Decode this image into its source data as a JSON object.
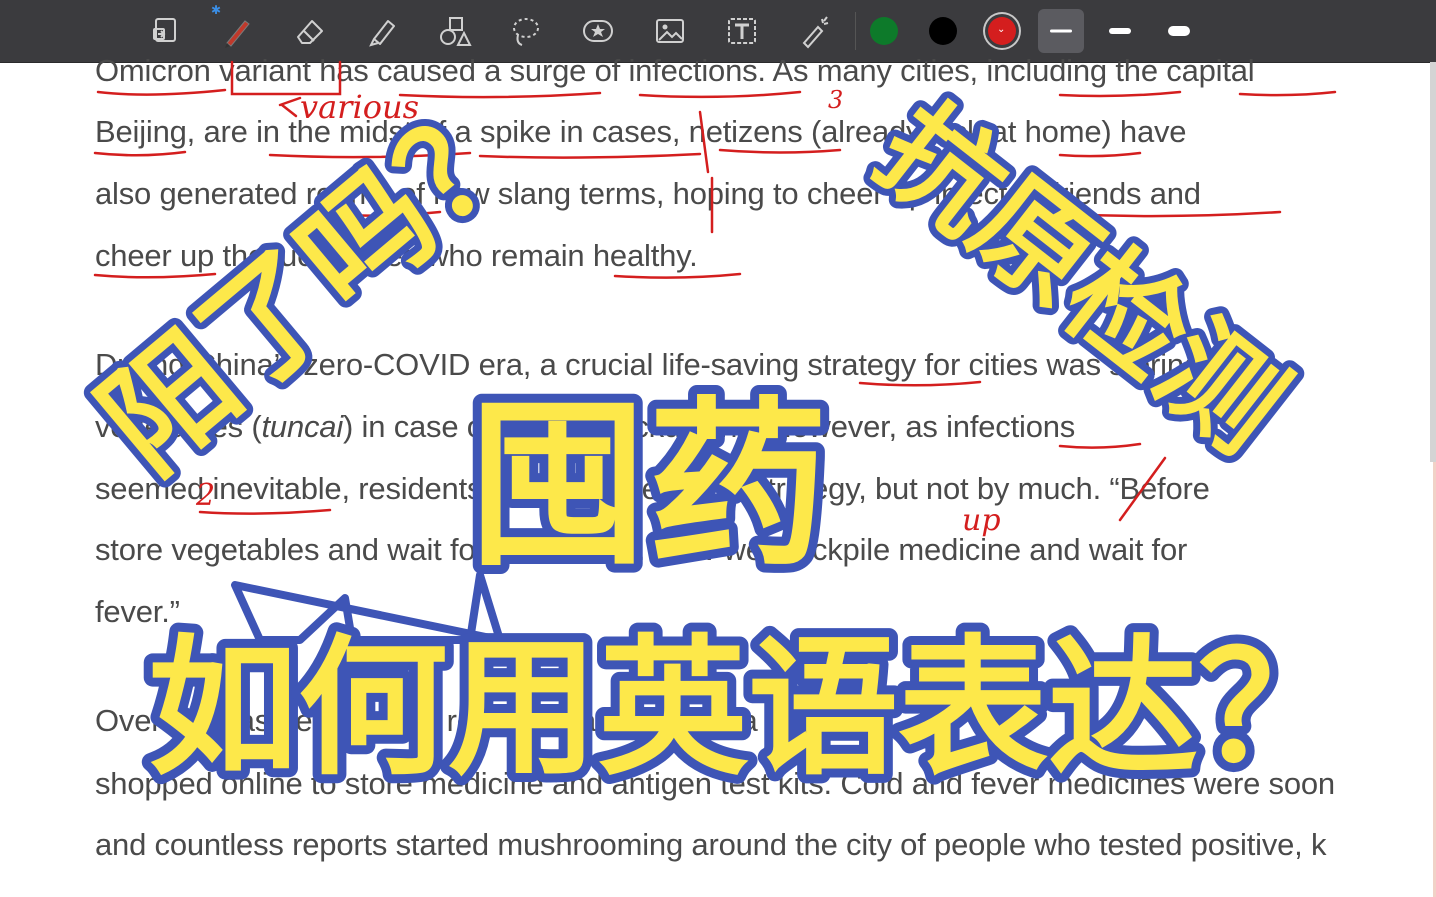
{
  "toolbar": {
    "tools": [
      {
        "name": "page-view-icon",
        "selected": false
      },
      {
        "name": "pen-icon",
        "selected": true,
        "bluetooth": true
      },
      {
        "name": "eraser-icon",
        "selected": false
      },
      {
        "name": "highlighter-icon",
        "selected": false
      },
      {
        "name": "shapes-icon",
        "selected": false
      },
      {
        "name": "lasso-icon",
        "selected": false
      },
      {
        "name": "sticker-icon",
        "selected": false
      },
      {
        "name": "image-icon",
        "selected": false
      },
      {
        "name": "text-icon",
        "selected": false
      },
      {
        "name": "laser-pointer-icon",
        "selected": false
      }
    ],
    "colors": [
      "#0d7a2a",
      "#000000",
      "#d41e1e"
    ],
    "selected_color": "#d41e1e",
    "stroke_widths": [
      "thin",
      "medium",
      "thick"
    ],
    "selected_stroke": "thin"
  },
  "document": {
    "lines": [
      "Omicron variant has caused a surge of infections. As many cities, including the capital",
      "Beijing, are in the midst of a spike in cases, netizens (already sick at home) have",
      "also generated reams of new slang terms, hoping to cheer up infected friends and",
      "cheer up the lucky ones who remain healthy.",
      "During China’s zero-COVID era, a crucial life-saving strategy for cities was storing",
      "vegetables (tuncai) in case of sudden lockdowns. However, as infections",
      "seemed inevitable, residents simply shifted their strategy, but not by much. “Before",
      "store vegetables and wait for lockdowns. Now we stockpile medicine and wait for",
      "fever.”",
      "Over the past few weeks, residents across China rushed to",
      "shopped online to store medicine and antigen test kits. Cold and fever medicines were soon",
      "and countless reports started mushrooming around the city of people who tested positive, k"
    ],
    "italic_word": "tuncai"
  },
  "annotations": {
    "various": "various",
    "up": "up",
    "mark_2": "2",
    "mark_3": "3"
  },
  "overlay": {
    "tag_yang": "阳了吗？",
    "tag_antigen": "抗原检测",
    "tag_tunyao": "囤药",
    "headline": "如何用英语表达？"
  },
  "colors": {
    "accent_yellow": "#fde84a",
    "accent_blue": "#3e55b6",
    "ink_red": "#d41e1e",
    "text_gray": "#4a4a4a"
  }
}
